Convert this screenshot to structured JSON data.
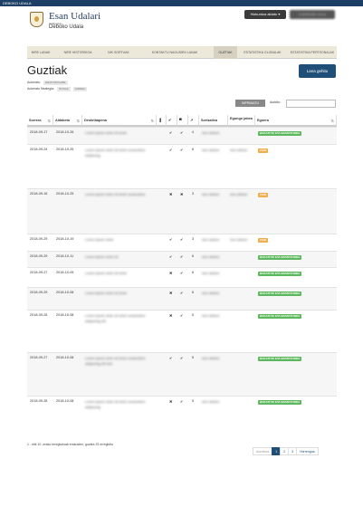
{
  "topbar": {
    "title": "DEBOKO UDALA"
  },
  "header": {
    "brand_name": "Esan Udalari",
    "brand_small": "Udalarekin",
    "brand_sub": "Deboko Udala",
    "lang_button": "Hizkuntza aldatu ▾",
    "user_button": "erabiltzaile izena"
  },
  "nav": {
    "items": [
      {
        "label": "NIRE LANAK"
      },
      {
        "label": "NIRE HISTORIKOA"
      },
      {
        "label": "NIK SORTUAK"
      },
      {
        "label": "KONTAKTU NAGUSIEN LANAK"
      },
      {
        "label": "GUZTIAK",
        "active": true
      },
      {
        "label": "ESTATISTIKA GLOBALAK"
      },
      {
        "label": "ESTATISTIKA PERTSONALAK"
      }
    ]
  },
  "page": {
    "title": "Guztiak",
    "new_button": "Lana gehitu",
    "filter1_label": "Aukeratu:",
    "filter1_value": "ERANTZUGABE",
    "filter2_label": "Aukeratu fitxategia:",
    "filter2_value1": "IKUSLE",
    "filter2_value2": "GIRREA"
  },
  "toolbar": {
    "print_button": "INPRIMATU",
    "search_label": "Aurkitu:",
    "search_value": ""
  },
  "table": {
    "headers": {
      "sorrera": "Sorrera",
      "aldaketa": "Aldaketa",
      "deskribapena": "Deskribapena",
      "c_file": "▐",
      "c_check": "✔",
      "c_folder": "▀",
      "c_arrow": "↗",
      "sortzailea": "Sortzailea",
      "egungo_jabea": "Egungo jabea",
      "egoera": "Egoera"
    },
    "rows": [
      {
        "sorrera": "2018-09-17",
        "aldaketa": "2018-10-26",
        "desc": "Lorem ipsum dolor sit amet",
        "c1": "",
        "c2": "✔",
        "c3": "✔",
        "c4": "4",
        "sortzailea": "Izen abizen",
        "jabea": "",
        "egoera": "BUKATUTA ETA ERANTZUNDA",
        "status": "green"
      },
      {
        "sorrera": "2018-09-24",
        "aldaketa": "2018-10-25",
        "desc": "Lorem ipsum dolor sit amet consectetur adipiscing",
        "c1": "",
        "c2": "✔",
        "c3": "✔",
        "c4": "6",
        "sortzailea": "Izen abizen",
        "jabea": "Izen abizen",
        "egoera": "ZAIN",
        "status": "orange"
      },
      {
        "sorrera": "2018-09-16",
        "aldaketa": "2018-10-25",
        "desc": "Lorem ipsum dolor sit amet consectetur",
        "c1": "",
        "c2": "✖",
        "c3": "✖",
        "c4": "3",
        "sortzailea": "Izen abizen",
        "jabea": "Izen abizen",
        "egoera": "ZAIN",
        "status": "orange"
      },
      {
        "sorrera": "2018-09-29",
        "aldaketa": "2018-10-19",
        "desc": "Lorem ipsum dolor",
        "c1": "",
        "c2": "✔",
        "c3": "✔",
        "c4": "3",
        "sortzailea": "Izen abizen",
        "jabea": "Izen abizen",
        "egoera": "ZAIN",
        "status": "orange"
      },
      {
        "sorrera": "2018-09-29",
        "aldaketa": "2018-10-11",
        "desc": "Lorem ipsum dolor sit",
        "c1": "",
        "c2": "✔",
        "c3": "✔",
        "c4": "6",
        "sortzailea": "Izen abizen",
        "jabea": "",
        "egoera": "BUKATUTA ETA ERANTZUNDA",
        "status": "green"
      },
      {
        "sorrera": "2018-09-27",
        "aldaketa": "2018-10-09",
        "desc": "Lorem ipsum dolor sit amet",
        "c1": "",
        "c2": "✖",
        "c3": "✔",
        "c4": "6",
        "sortzailea": "Izen abizen",
        "jabea": "",
        "egoera": "BUKATUTA ETA ERANTZUNDA",
        "status": "green"
      },
      {
        "sorrera": "2018-09-29",
        "aldaketa": "2018-10-08",
        "desc": "Lorem ipsum dolor sit amet",
        "c1": "",
        "c2": "✖",
        "c3": "✔",
        "c4": "6",
        "sortzailea": "Izen abizen",
        "jabea": "",
        "egoera": "BUKATUTA ETA ERANTZUNDA",
        "status": "green"
      },
      {
        "sorrera": "2018-09-28",
        "aldaketa": "2018-10-08",
        "desc": "Lorem ipsum dolor sit amet consectetur adipiscing elit",
        "c1": "",
        "c2": "✖",
        "c3": "✔",
        "c4": "5",
        "sortzailea": "Izen abizen",
        "jabea": "",
        "egoera": "BUKATUTA ETA ERANTZUNDA",
        "status": "green"
      },
      {
        "sorrera": "2018-09-27",
        "aldaketa": "2018-10-08",
        "desc": "Lorem ipsum dolor sit amet consectetur adipiscing elit sed",
        "c1": "",
        "c2": "✔",
        "c3": "✔",
        "c4": "5",
        "sortzailea": "Izen abizen",
        "jabea": "",
        "egoera": "BUKATUTA ETA ERANTZUNDA",
        "status": "green"
      },
      {
        "sorrera": "2018-09-28",
        "aldaketa": "2018-10-08",
        "desc": "Lorem ipsum dolor sit amet consectetur adipiscing",
        "c1": "",
        "c2": "✖",
        "c3": "✔",
        "c4": "5",
        "sortzailea": "Izen abizen",
        "jabea": "",
        "egoera": "BUKATUTA ETA ERANTZUNDA",
        "status": "green"
      }
    ]
  },
  "footer": {
    "info": "1 - etik 10 -erako erregistroak erakusten, guztira 23 erregistro",
    "pager": [
      "Aurrekoa",
      "1",
      "2",
      "3",
      "Hurrengoa"
    ]
  }
}
